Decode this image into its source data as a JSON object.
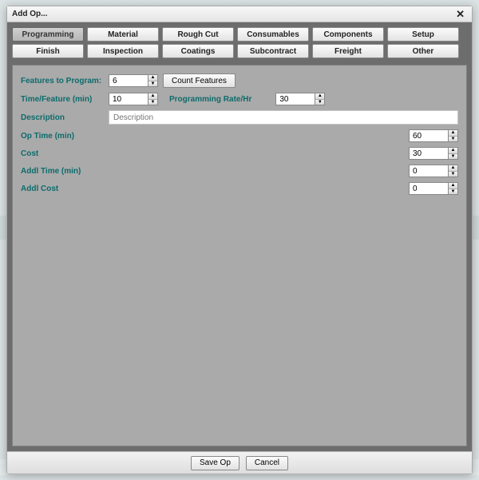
{
  "dialog": {
    "title": "Add Op..."
  },
  "tabs": [
    {
      "label": "Programming",
      "active": true
    },
    {
      "label": "Material"
    },
    {
      "label": "Rough Cut"
    },
    {
      "label": "Consumables"
    },
    {
      "label": "Components"
    },
    {
      "label": "Setup"
    },
    {
      "label": "Finish"
    },
    {
      "label": "Inspection"
    },
    {
      "label": "Coatings"
    },
    {
      "label": "Subcontract"
    },
    {
      "label": "Freight"
    },
    {
      "label": "Other"
    }
  ],
  "form": {
    "features_label": "Features to Program:",
    "features_value": "6",
    "count_features_btn": "Count Features",
    "time_per_feature_label": "Time/Feature (min)",
    "time_per_feature_value": "10",
    "prog_rate_label": "Programming Rate/Hr",
    "prog_rate_value": "30",
    "description_label": "Description",
    "description_placeholder": "Description",
    "op_time_label": "Op Time (min)",
    "op_time_value": "60",
    "cost_label": "Cost",
    "cost_value": "30",
    "addl_time_label": "Addl Time (min)",
    "addl_time_value": "0",
    "addl_cost_label": "Addl Cost",
    "addl_cost_value": "0"
  },
  "footer": {
    "save": "Save Op",
    "cancel": "Cancel"
  }
}
